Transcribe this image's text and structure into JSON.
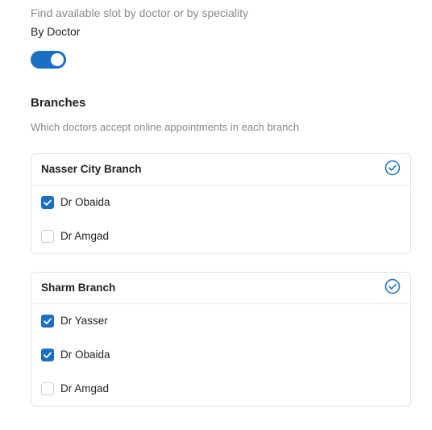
{
  "hint": "Find available slot by doctor or by speciality",
  "mode_label": "By Doctor",
  "toggle_on": true,
  "branches": {
    "title": "Branches",
    "subtitle": "Which doctors accept online appointments in each branch",
    "cards": [
      {
        "name": "Nasser City Branch",
        "doctors": [
          {
            "name": "Dr Obaida",
            "checked": true
          },
          {
            "name": "Dr Amgad",
            "checked": false
          }
        ]
      },
      {
        "name": "Sharm Branch",
        "doctors": [
          {
            "name": "Dr Yasser",
            "checked": true
          },
          {
            "name": "Dr Obaida",
            "checked": true
          },
          {
            "name": "Dr Amgad",
            "checked": false
          }
        ]
      }
    ]
  },
  "colors": {
    "accent": "#1a6fc4",
    "muted_text": "#8a8a8a"
  }
}
